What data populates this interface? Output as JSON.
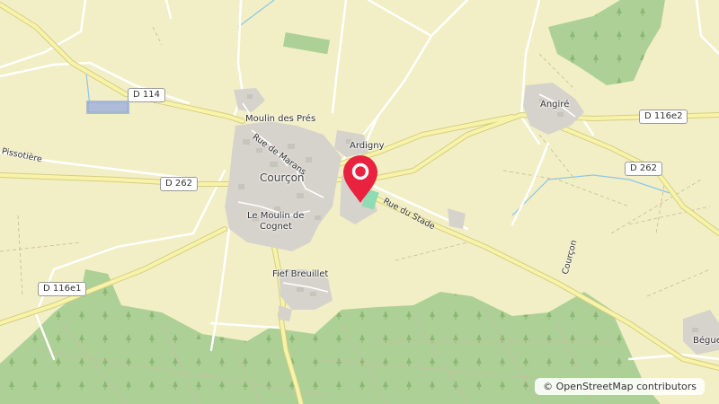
{
  "map": {
    "places": {
      "courcon": "Courçon",
      "moulin_des_pres": "Moulin des Prés",
      "ardigny": "Ardigny",
      "angire": "Angiré",
      "moulin_de_cognet_line1": "Le Moulin de",
      "moulin_de_cognet_line2": "Cognet",
      "fief_breuillet": "Fief Breuillet",
      "begue": "Bégue",
      "pissotiere": "Pissotière",
      "courcon_road": "Courçon"
    },
    "roads": {
      "d114": "D 114",
      "d262_west": "D 262",
      "d262_east": "D 262",
      "d116e2": "D 116e2",
      "d116e1": "D 116e1",
      "rue_de_marans": "Rue de Marans",
      "rue_du_stade": "Rue du Stade"
    },
    "marker": {
      "icon": "map-pin-icon",
      "color": "#e8223f"
    },
    "attribution": {
      "symbol": "©",
      "text": "OpenStreetMap contributors"
    },
    "colors": {
      "land": "#f2efc6",
      "forest": "#a7cc8f",
      "road_major": "#f7f4a9",
      "road_casing": "#d5cf84",
      "builtup": "#d6d3cd",
      "water": "#8bc7e8"
    }
  }
}
